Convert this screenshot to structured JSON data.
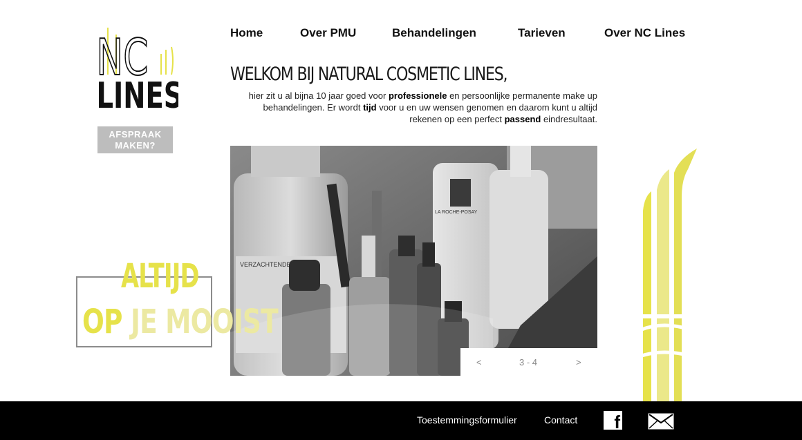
{
  "brand": {
    "logo_line1": "NC",
    "logo_line2": "LINES"
  },
  "cta": {
    "label": "AFSPRAAK MAKEN?"
  },
  "nav": {
    "items": [
      "Home",
      "Over PMU",
      "Behandelingen",
      "Tarieven",
      "Over NC Lines"
    ]
  },
  "main": {
    "headline": "WELKOM BIJ NATURAL COSMETIC LINES,",
    "intro": {
      "p1": "hier zit u al bijna 10 jaar goed voor ",
      "b1": "professionele",
      "p2": " en persoonlijke permanente make up behandelingen. Er wordt ",
      "b2": "tijd",
      "p3": " voor u en uw wensen genomen en daarom kunt u altijd rekenen op een perfect ",
      "b3": "passend",
      "p4": " eindresultaat."
    }
  },
  "slider": {
    "prev": "<",
    "counter": "3 - 4",
    "next": ">",
    "photo_labels": {
      "bottle_left": "VERZACHTENDE",
      "bottle_right": "LA ROCHE-POSAY"
    }
  },
  "tagline": {
    "line1": "ALTIJD",
    "line2_a": "OP",
    "line2_b": "JE MOOIST"
  },
  "footer": {
    "links": [
      "Toestemmingsformulier",
      "Contact"
    ],
    "facebook_glyph": "f"
  },
  "colors": {
    "accent": "#e6e24a",
    "footer_bg": "#000000",
    "cta_bg": "#bdbdbd"
  },
  "icons": {
    "facebook": "facebook-icon",
    "mail": "mail-icon"
  }
}
